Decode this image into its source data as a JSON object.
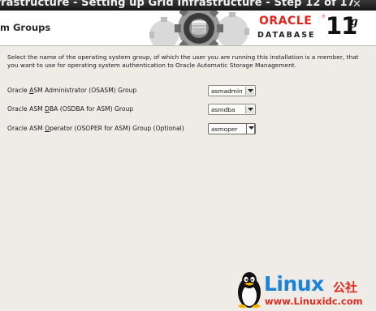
{
  "window": {
    "title": "nfrastructure - Setting up Grid Infrastructure - Step 12 of 17",
    "close_glyph": "✕"
  },
  "header": {
    "page_title": "m Groups",
    "brand": {
      "oracle": "ORACLE",
      "database": "DATABASE",
      "version": "11",
      "version_suffix": "g"
    }
  },
  "main": {
    "instructions": "Select the name of the operating system group, of which the user you are running this installation is a member, that you want to use for operating system authentication to Oracle Automatic Storage Management.",
    "groups": [
      {
        "label_before": "Oracle ",
        "label_mnemonic": "A",
        "label_after": "SM Administrator (OSASM) Group",
        "selected": "asmadmin"
      },
      {
        "label_before": "Oracle ASM ",
        "label_mnemonic": "D",
        "label_after": "BA (OSDBA for ASM) Group",
        "selected": "asmdba"
      },
      {
        "label_before": "Oracle ASM ",
        "label_mnemonic": "O",
        "label_after": "perator (OSOPER for ASM) Group (Optional)",
        "selected": "asmoper"
      }
    ]
  },
  "watermark": {
    "brand": "Linux",
    "brand_cn": "公社",
    "url": "www.Linuxidc.com"
  },
  "colors": {
    "oracle_red": "#e2261c",
    "background": "#efebe7",
    "titlebar": "#1f1f1f",
    "watermark_blue": "#1d83d6",
    "watermark_red": "#e02a20"
  },
  "icons": [
    "close-icon",
    "gears-graphic",
    "dropdown-arrow-icon",
    "penguin-icon"
  ]
}
